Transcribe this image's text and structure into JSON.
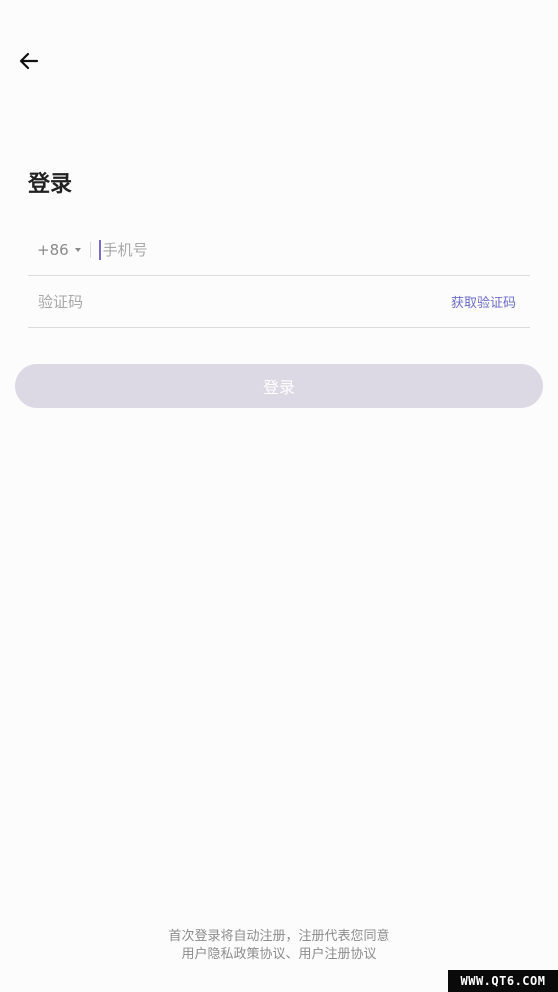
{
  "header": {
    "back_icon": "arrow-left-icon"
  },
  "title": "登录",
  "phone": {
    "country_code": "+86",
    "placeholder": "手机号",
    "value": ""
  },
  "code": {
    "placeholder": "验证码",
    "value": "",
    "get_code_label": "获取验证码"
  },
  "login_button": {
    "label": "登录"
  },
  "agreement": {
    "line1": "首次登录将自动注册，注册代表您同意",
    "privacy_link": "用户隐私政策协议",
    "separator": "、",
    "terms_link": "用户注册协议"
  },
  "watermark": "WWW.QT6.COM",
  "colors": {
    "accent": "#6a6cc8",
    "button_disabled": "#dcd8e4",
    "cursor": "#7b6cc9"
  }
}
